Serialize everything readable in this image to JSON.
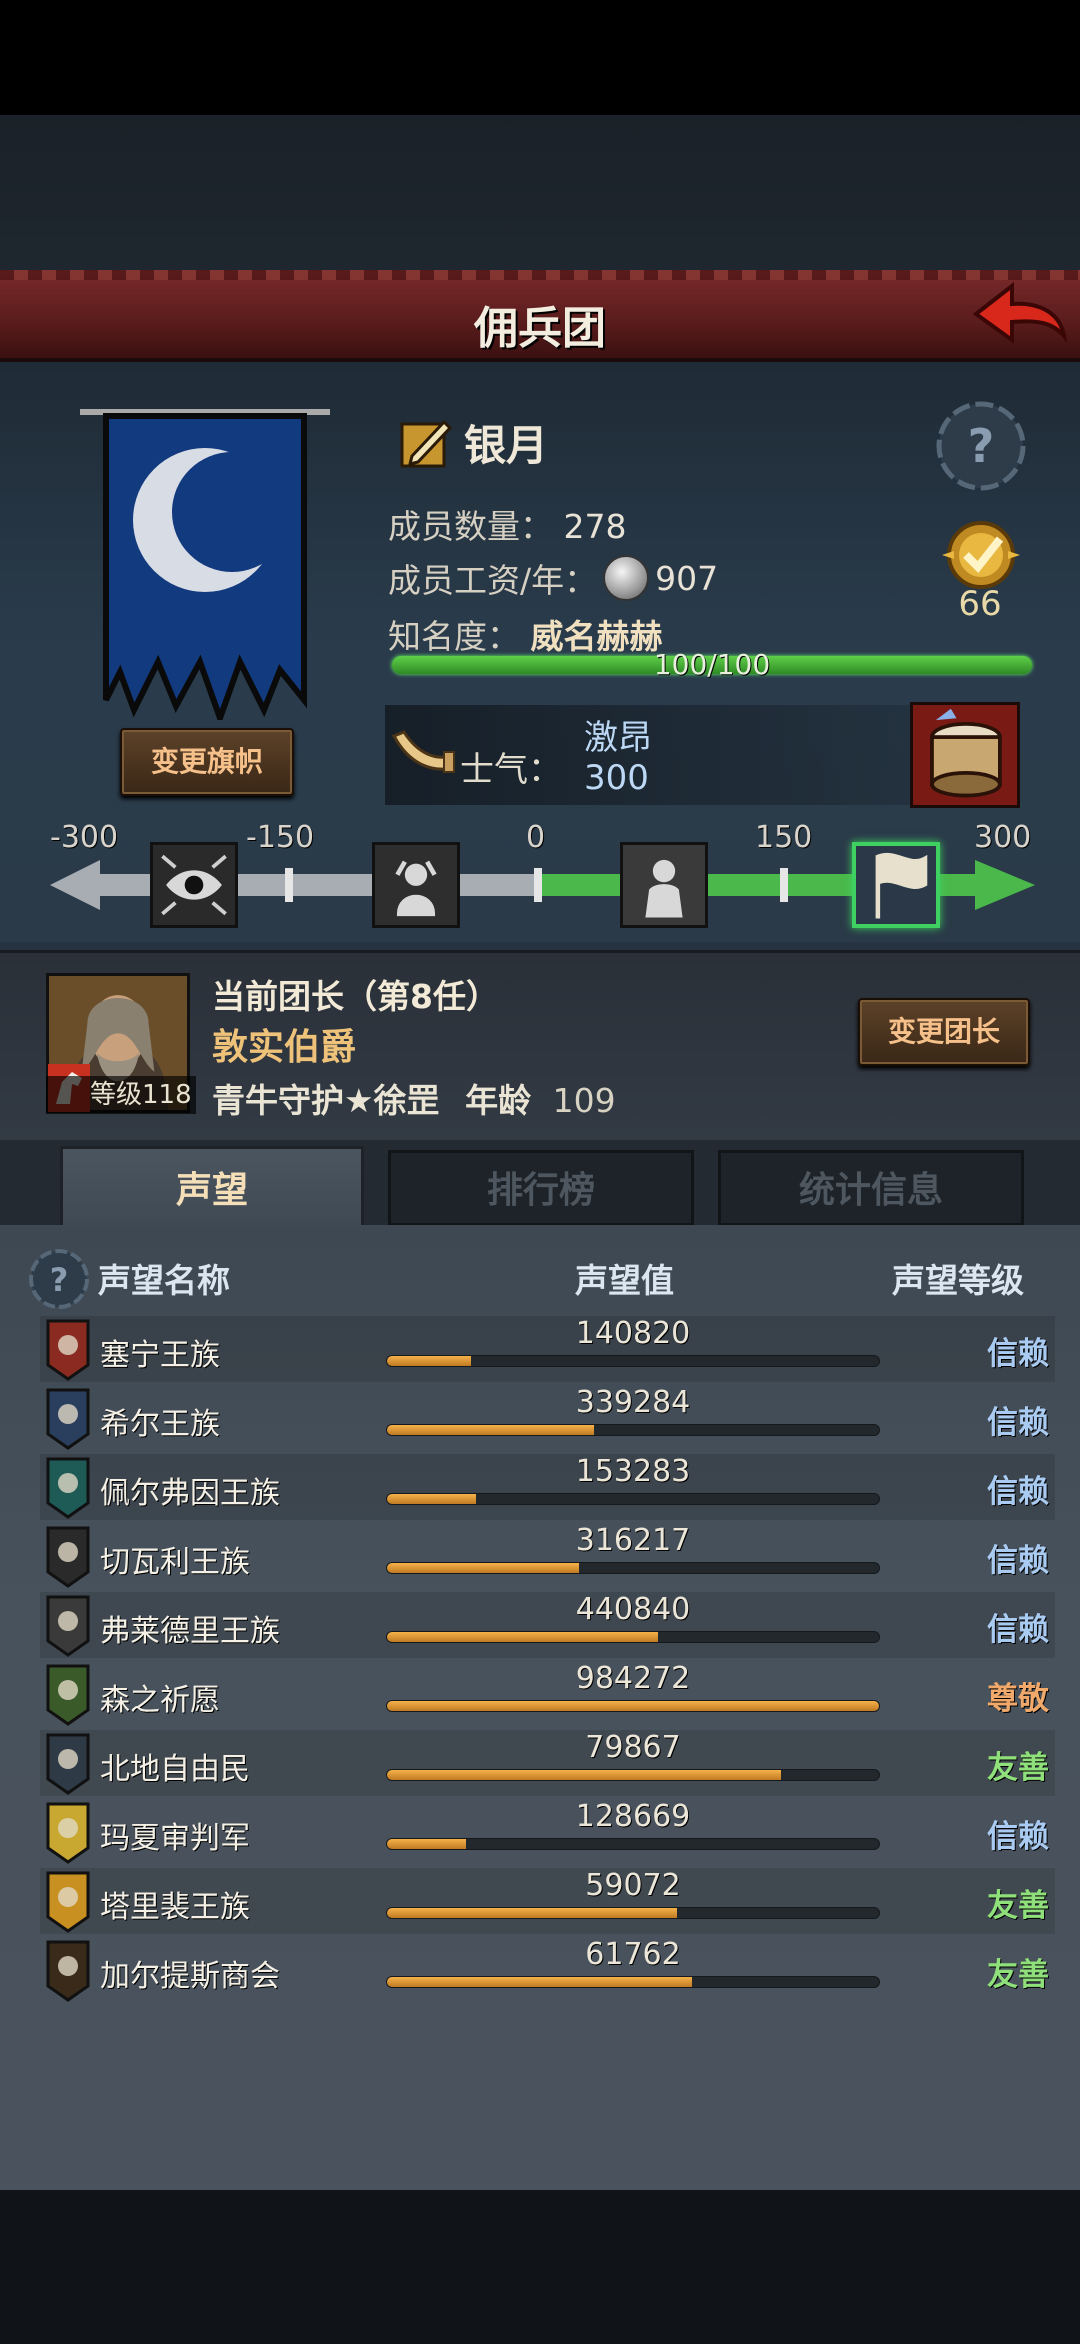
{
  "header": {
    "title": "佣兵团"
  },
  "guild": {
    "name": "银月",
    "members_label": "成员数量：",
    "members_value": "278",
    "wage_label": "成员工资/年：",
    "wage_value": "907",
    "fame_label": "知名度：",
    "fame_value": "威名赫赫",
    "fame_progress": "100/100",
    "badge_count": "66",
    "change_flag_label": "变更旗帜"
  },
  "morale": {
    "label": "士气：",
    "state": "激昂",
    "value": "300",
    "scale_labels": [
      "-300",
      "-150",
      "0",
      "150",
      "300"
    ]
  },
  "commander": {
    "title": "当前团长（第8任）",
    "name": "敦实伯爵",
    "level_label": "等级118",
    "info": "青牛守护★徐罡",
    "age_label": "年龄",
    "age_value": "109",
    "change_leader_label": "变更团长"
  },
  "tabs": [
    {
      "label": "声望",
      "active": true
    },
    {
      "label": "排行榜",
      "active": false
    },
    {
      "label": "统计信息",
      "active": false
    }
  ],
  "table": {
    "col_name": "声望名称",
    "col_value": "声望值",
    "col_level": "声望等级",
    "rows": [
      {
        "name": "塞宁王族",
        "value": "140820",
        "fill": 0.17,
        "level": "信赖",
        "color": "#8a2a20"
      },
      {
        "name": "希尔王族",
        "value": "339284",
        "fill": 0.42,
        "level": "信赖",
        "color": "#2a3e5e"
      },
      {
        "name": "佩尔弗因王族",
        "value": "153283",
        "fill": 0.18,
        "level": "信赖",
        "color": "#1e5a56"
      },
      {
        "name": "切瓦利王族",
        "value": "316217",
        "fill": 0.39,
        "level": "信赖",
        "color": "#2a2a2a"
      },
      {
        "name": "弗莱德里王族",
        "value": "440840",
        "fill": 0.55,
        "level": "信赖",
        "color": "#3a3a3a"
      },
      {
        "name": "森之祈愿",
        "value": "984272",
        "fill": 1.0,
        "level": "尊敬",
        "color": "#3a5a2a"
      },
      {
        "name": "北地自由民",
        "value": "79867",
        "fill": 0.8,
        "level": "友善",
        "color": "#2e3a46"
      },
      {
        "name": "玛夏审判军",
        "value": "128669",
        "fill": 0.16,
        "level": "信赖",
        "color": "#c8a830"
      },
      {
        "name": "塔里裴王族",
        "value": "59072",
        "fill": 0.59,
        "level": "友善",
        "color": "#c89020"
      },
      {
        "name": "加尔提斯商会",
        "value": "61762",
        "fill": 0.62,
        "level": "友善",
        "color": "#3a2a1a"
      }
    ]
  }
}
